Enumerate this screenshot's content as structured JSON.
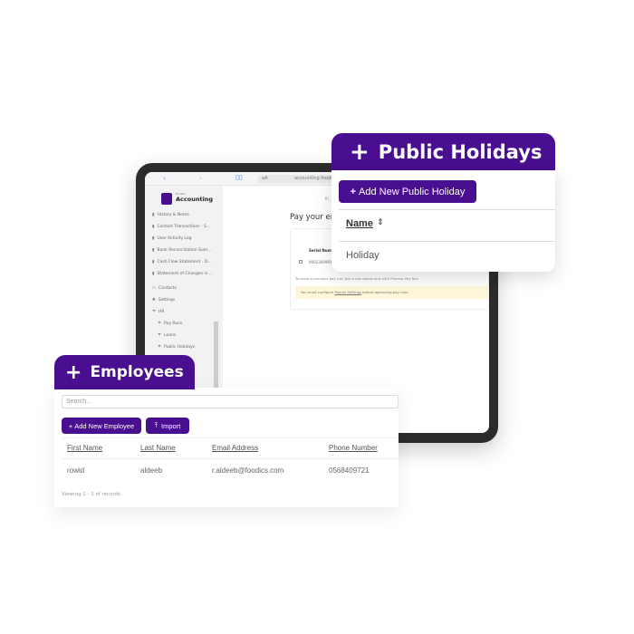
{
  "tablet": {
    "address_bar": "accounting.foodics",
    "aa_label": "aA",
    "app_brand_small": "foodics",
    "app_name": "Accounting",
    "sidebar": [
      {
        "label": "History & Notes",
        "icon": "bar-chart-icon"
      },
      {
        "label": "Contact Transactions - S...",
        "icon": "bar-chart-icon"
      },
      {
        "label": "User Activity Log",
        "icon": "bar-chart-icon"
      },
      {
        "label": "Bank Reconciliation Sum...",
        "icon": "bar-chart-icon"
      },
      {
        "label": "Cash Flow Statement - D...",
        "icon": "bar-chart-icon"
      },
      {
        "label": "Statement of Changes in ...",
        "icon": "bar-chart-icon"
      },
      {
        "label": "Contacts",
        "icon": "contacts-icon"
      },
      {
        "label": "Settings",
        "icon": "gear-icon"
      },
      {
        "label": "HR",
        "icon": "umbrella-icon"
      },
      {
        "label": "Pay Runs",
        "icon": "umbrella-icon"
      },
      {
        "label": "Loans",
        "icon": "umbrella-icon"
      },
      {
        "label": "Public Holidays",
        "icon": "umbrella-icon"
      }
    ],
    "main": {
      "small_top": "Ri",
      "heading": "Pay your em",
      "col_header": "Serial Num",
      "row_value": "9902309991",
      "hint": "To clone a previous pay run, tick a row above and click Process Pay Run",
      "warning_prefix": "You must configure ",
      "warning_link": "Payroll Settings",
      "warning_suffix": " before approving pay runs."
    }
  },
  "holidays": {
    "title": "Public Holidays",
    "add_button": "Add New Public Holiday",
    "col_name": "Name",
    "rows": [
      "Holiday"
    ]
  },
  "employees": {
    "title": "Employees",
    "search_placeholder": "Search...",
    "add_button": "Add New Employee",
    "import_button": "Import",
    "columns": [
      "First Name",
      "Last Name",
      "Email Address",
      "Phone Number"
    ],
    "rows": [
      [
        "rowid",
        "aldeeb",
        "r.aldeeb@foodics.com",
        "0568409721"
      ]
    ],
    "footer": "Viewing 1 - 1 of records"
  },
  "colors": {
    "accent": "#4a0e91",
    "warning_bg": "#fdf6d8"
  }
}
